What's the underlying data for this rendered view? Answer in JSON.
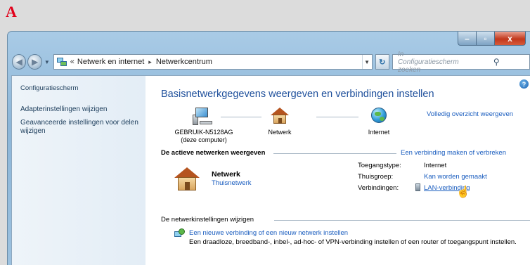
{
  "panel_letter": "A",
  "window": {
    "controls": {
      "minimize": "–",
      "maximize": "▫",
      "close": "x"
    }
  },
  "address_bar": {
    "chevron": "«",
    "crumbs": [
      "Netwerk en internet",
      "Netwerkcentrum"
    ],
    "separator": "▸",
    "refresh": "↻"
  },
  "search": {
    "placeholder": "In Configuratiescherm zoeken"
  },
  "sidebar": {
    "home": "Configuratiescherm",
    "links": [
      "Adapterinstellingen wijzigen",
      "Geavanceerde instellingen voor delen wijzigen"
    ]
  },
  "main": {
    "title": "Basisnetwerkgegevens weergeven en verbindingen instellen",
    "full_map_link": "Volledig overzicht weergeven",
    "map": {
      "computer_name": "GEBRUIK-N5128AG",
      "computer_note": "(deze computer)",
      "network_label": "Netwerk",
      "internet_label": "Internet"
    },
    "active_networks": {
      "heading": "De actieve netwerken weergeven",
      "connect_link": "Een verbinding maken of verbreken",
      "network_name": "Netwerk",
      "network_type": "Thuisnetwerk",
      "access_type_label": "Toegangstype:",
      "access_type_value": "Internet",
      "homegroup_label": "Thuisgroep:",
      "homegroup_value": "Kan worden gemaakt",
      "connections_label": "Verbindingen:",
      "connections_value": "LAN-verbinding"
    },
    "change_settings": {
      "heading": "De netwerkinstellingen wijzigen",
      "new_connection_link": "Een nieuwe verbinding of een nieuw netwerk instellen",
      "new_connection_desc": "Een draadloze, breedband-, inbel-, ad-hoc- of VPN-verbinding instellen of een router of toegangspunt instellen."
    }
  },
  "colors": {
    "accent_link": "#1a5dbf",
    "title_blue": "#1e4f9b",
    "panel_letter": "#e2001a"
  }
}
